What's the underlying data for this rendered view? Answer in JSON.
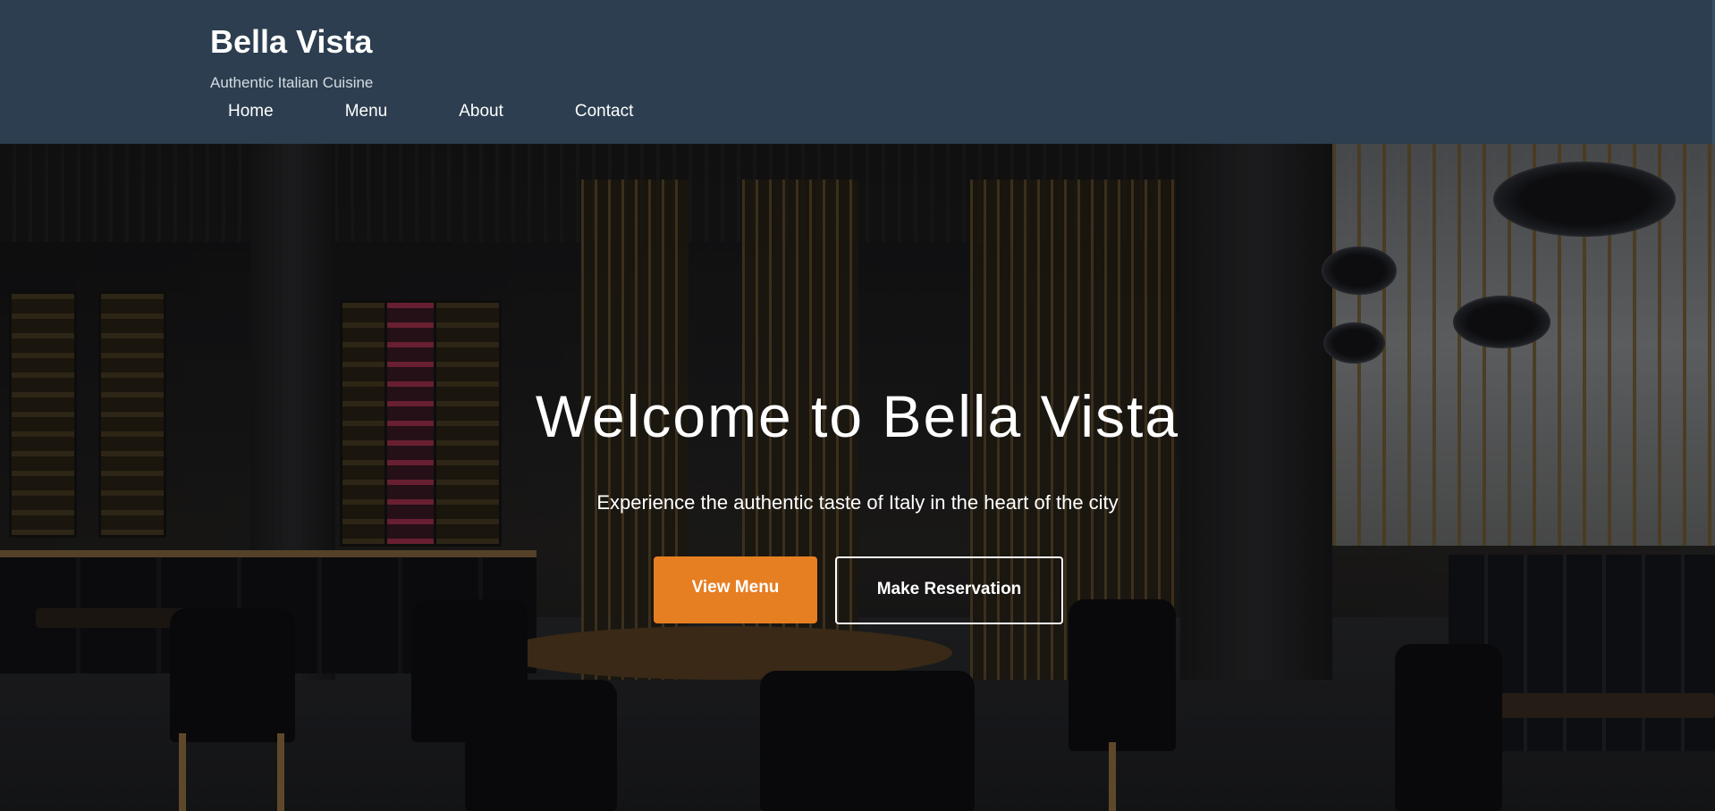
{
  "header": {
    "brand": "Bella Vista",
    "tagline": "Authentic Italian Cuisine",
    "nav": [
      {
        "label": "Home"
      },
      {
        "label": "Menu"
      },
      {
        "label": "About"
      },
      {
        "label": "Contact"
      }
    ],
    "background_color": "#2c3e50"
  },
  "hero": {
    "title": "Welcome to Bella Vista",
    "subtitle": "Experience the authentic taste of Italy in the heart of the city",
    "primary_button": "View Menu",
    "secondary_button": "Make Reservation",
    "accent_color": "#e67e22",
    "background_image": "restaurant-interior"
  }
}
